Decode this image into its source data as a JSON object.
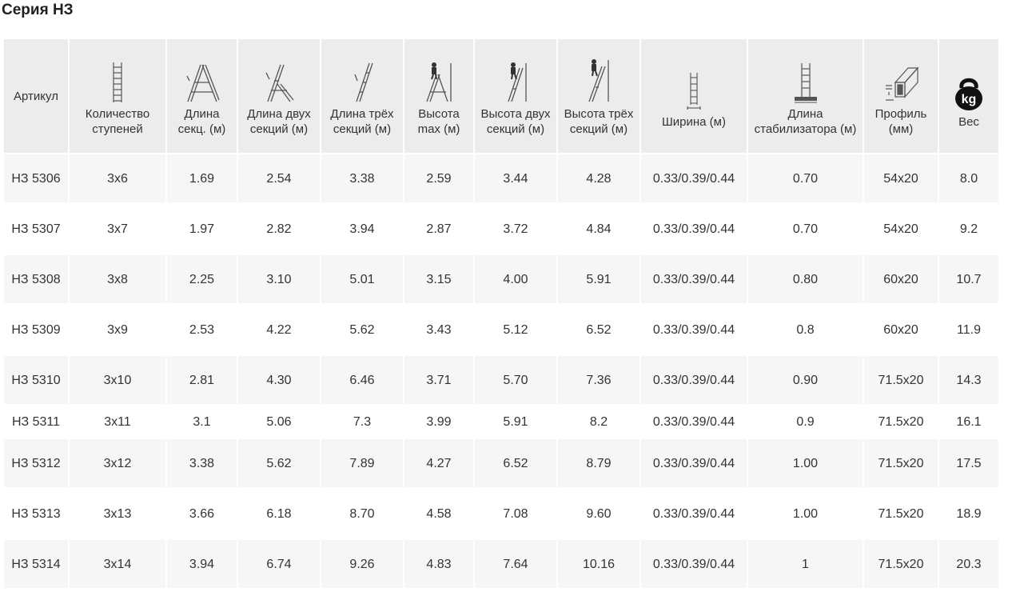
{
  "title": "Серия НЗ",
  "columns": [
    {
      "key": "article",
      "label": "Артикул",
      "icon": ""
    },
    {
      "key": "steps",
      "label": "Количество ступеней",
      "icon": "ladder-steps-icon"
    },
    {
      "key": "section_len",
      "label": "Длина секц. (м)",
      "icon": "a-frame-ladder-icon"
    },
    {
      "key": "two_sec_len",
      "label": "Длина двух секций (м)",
      "icon": "two-section-ladder-icon"
    },
    {
      "key": "three_sec_len",
      "label": "Длина трёх секций (м)",
      "icon": "three-section-ladder-icon"
    },
    {
      "key": "max_height",
      "label": "Высота max (м)",
      "icon": "person-on-ladder-icon"
    },
    {
      "key": "two_sec_height",
      "label": "Высота двух секций (м)",
      "icon": "person-two-section-icon"
    },
    {
      "key": "three_sec_height",
      "label": "Высота трёх секций (м)",
      "icon": "person-three-section-icon"
    },
    {
      "key": "width",
      "label": "Ширина (м)",
      "icon": "ladder-width-icon"
    },
    {
      "key": "stabilizer",
      "label": "Длина стабилизатора (м)",
      "icon": "stabilizer-icon"
    },
    {
      "key": "profile",
      "label": "Профиль (мм)",
      "icon": "profile-section-icon"
    },
    {
      "key": "weight",
      "label": "Вес",
      "icon": "kettlebell-kg-icon",
      "icon_text": "kg"
    }
  ],
  "rows": [
    {
      "article": "НЗ 5306",
      "steps": "3x6",
      "section_len": "1.69",
      "two_sec_len": "2.54",
      "three_sec_len": "3.38",
      "max_height": "2.59",
      "two_sec_height": "3.44",
      "three_sec_height": "4.28",
      "width": "0.33/0.39/0.44",
      "stabilizer": "0.70",
      "profile": "54x20",
      "weight": "8.0"
    },
    {
      "article": "НЗ 5307",
      "steps": "3x7",
      "section_len": "1.97",
      "two_sec_len": "2.82",
      "three_sec_len": "3.94",
      "max_height": "2.87",
      "two_sec_height": "3.72",
      "three_sec_height": "4.84",
      "width": "0.33/0.39/0.44",
      "stabilizer": "0.70",
      "profile": "54x20",
      "weight": "9.2"
    },
    {
      "article": "НЗ 5308",
      "steps": "3x8",
      "section_len": "2.25",
      "two_sec_len": "3.10",
      "three_sec_len": "5.01",
      "max_height": "3.15",
      "two_sec_height": "4.00",
      "three_sec_height": "5.91",
      "width": "0.33/0.39/0.44",
      "stabilizer": "0.80",
      "profile": "60x20",
      "weight": "10.7"
    },
    {
      "article": "НЗ 5309",
      "steps": "3x9",
      "section_len": "2.53",
      "two_sec_len": "4.22",
      "three_sec_len": "5.62",
      "max_height": "3.43",
      "two_sec_height": "5.12",
      "three_sec_height": "6.52",
      "width": "0.33/0.39/0.44",
      "stabilizer": "0.8",
      "profile": "60x20",
      "weight": "11.9"
    },
    {
      "article": "НЗ 5310",
      "steps": "3x10",
      "section_len": "2.81",
      "two_sec_len": "4.30",
      "three_sec_len": "6.46",
      "max_height": "3.71",
      "two_sec_height": "5.70",
      "three_sec_height": "7.36",
      "width": "0.33/0.39/0.44",
      "stabilizer": "0.90",
      "profile": "71.5x20",
      "weight": "14.3"
    },
    {
      "article": "НЗ 5311",
      "steps": "3x11",
      "section_len": "3.1",
      "two_sec_len": "5.06",
      "three_sec_len": "7.3",
      "max_height": "3.99",
      "two_sec_height": "5.91",
      "three_sec_height": "8.2",
      "width": "0.33/0.39/0.44",
      "stabilizer": "0.9",
      "profile": "71.5x20",
      "weight": "16.1"
    },
    {
      "article": "НЗ 5312",
      "steps": "3x12",
      "section_len": "3.38",
      "two_sec_len": "5.62",
      "three_sec_len": "7.89",
      "max_height": "4.27",
      "two_sec_height": "6.52",
      "three_sec_height": "8.79",
      "width": "0.33/0.39/0.44",
      "stabilizer": "1.00",
      "profile": "71.5x20",
      "weight": "17.5"
    },
    {
      "article": "НЗ 5313",
      "steps": "3x13",
      "section_len": "3.66",
      "two_sec_len": "6.18",
      "three_sec_len": "8.70",
      "max_height": "4.58",
      "two_sec_height": "7.08",
      "three_sec_height": "9.60",
      "width": "0.33/0.39/0.44",
      "stabilizer": "1.00",
      "profile": "71.5x20",
      "weight": "18.9"
    },
    {
      "article": "НЗ 5314",
      "steps": "3x14",
      "section_len": "3.94",
      "two_sec_len": "6.74",
      "three_sec_len": "9.26",
      "max_height": "4.83",
      "two_sec_height": "7.64",
      "three_sec_height": "10.16",
      "width": "0.33/0.39/0.44",
      "stabilizer": "1",
      "profile": "71.5x20",
      "weight": "20.3"
    }
  ]
}
